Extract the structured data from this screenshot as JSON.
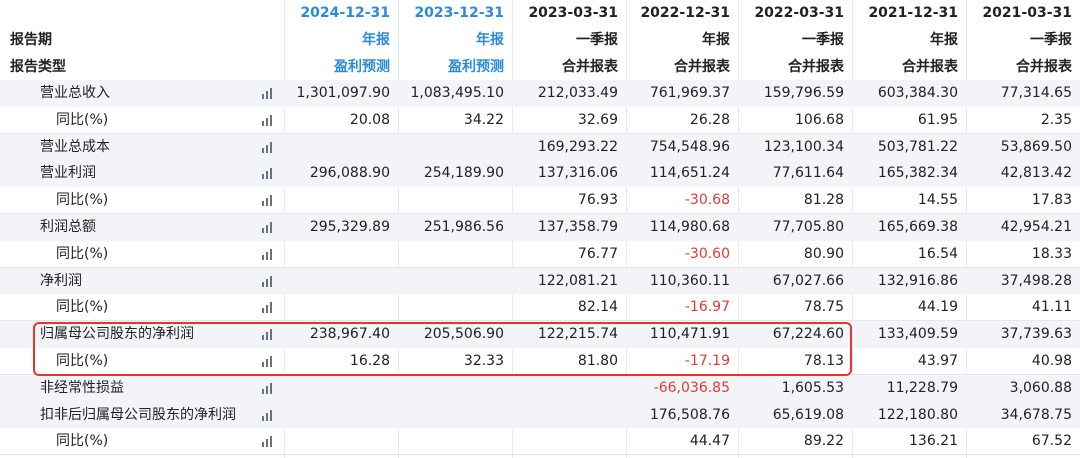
{
  "columns": [
    "2024-12-31",
    "2023-12-31",
    "2023-03-31",
    "2022-12-31",
    "2022-03-31",
    "2021-12-31",
    "2021-03-31"
  ],
  "column_styles": [
    "blue",
    "blue",
    "normal",
    "normal",
    "normal",
    "normal",
    "normal"
  ],
  "report_period": {
    "label": "报告期",
    "values": [
      "年报",
      "年报",
      "一季报",
      "年报",
      "一季报",
      "年报",
      "一季报"
    ]
  },
  "report_type": {
    "label": "报告类型",
    "values": [
      "盈利预测",
      "盈利预测",
      "合并报表",
      "合并报表",
      "合并报表",
      "合并报表",
      "合并报表"
    ]
  },
  "highlight_color": "#e8352b",
  "accent_color": "#2c8bd8",
  "negative_color": "#e23a3a",
  "rows": [
    {
      "label": "营业总收入",
      "indent": 1,
      "values": [
        "1,301,097.90",
        "1,083,495.10",
        "212,033.49",
        "761,969.37",
        "159,796.59",
        "603,384.30",
        "77,314.65"
      ]
    },
    {
      "label": "同比(%)",
      "indent": 2,
      "values": [
        "20.08",
        "34.22",
        "32.69",
        "26.28",
        "106.68",
        "61.95",
        "2.35"
      ]
    },
    {
      "label": "营业总成本",
      "indent": 1,
      "values": [
        "",
        "",
        "169,293.22",
        "754,548.96",
        "123,100.34",
        "503,781.22",
        "53,869.50"
      ]
    },
    {
      "label": "营业利润",
      "indent": 1,
      "values": [
        "296,088.90",
        "254,189.90",
        "137,316.06",
        "114,651.24",
        "77,611.64",
        "165,382.34",
        "42,813.42"
      ]
    },
    {
      "label": "同比(%)",
      "indent": 2,
      "values": [
        "",
        "",
        "76.93",
        "-30.68",
        "81.28",
        "14.55",
        "17.83"
      ]
    },
    {
      "label": "利润总额",
      "indent": 1,
      "values": [
        "295,329.89",
        "251,986.56",
        "137,358.79",
        "114,980.68",
        "77,705.80",
        "165,669.38",
        "42,954.21"
      ]
    },
    {
      "label": "同比(%)",
      "indent": 2,
      "values": [
        "",
        "",
        "76.77",
        "-30.60",
        "80.90",
        "16.54",
        "18.33"
      ]
    },
    {
      "label": "净利润",
      "indent": 1,
      "values": [
        "",
        "",
        "122,081.21",
        "110,360.11",
        "67,027.66",
        "132,916.86",
        "37,498.28"
      ]
    },
    {
      "label": "同比(%)",
      "indent": 2,
      "values": [
        "",
        "",
        "82.14",
        "-16.97",
        "78.75",
        "44.19",
        "41.11"
      ]
    },
    {
      "label": "归属母公司股东的净利润",
      "indent": 1,
      "values": [
        "238,967.40",
        "205,506.90",
        "122,215.74",
        "110,471.91",
        "67,224.60",
        "133,409.59",
        "37,739.63"
      ]
    },
    {
      "label": "同比(%)",
      "indent": 2,
      "values": [
        "16.28",
        "32.33",
        "81.80",
        "-17.19",
        "78.13",
        "43.97",
        "40.98"
      ]
    },
    {
      "label": "非经常性损益",
      "indent": 1,
      "values": [
        "",
        "",
        "",
        "-66,036.85",
        "1,605.53",
        "11,228.79",
        "3,060.88"
      ]
    },
    {
      "label": "扣非后归属母公司股东的净利润",
      "indent": 1,
      "values": [
        "",
        "",
        "",
        "176,508.76",
        "65,619.08",
        "122,180.80",
        "34,678.75"
      ]
    },
    {
      "label": "同比(%)",
      "indent": 2,
      "values": [
        "",
        "",
        "",
        "44.47",
        "89.22",
        "136.21",
        "67.52"
      ]
    }
  ]
}
